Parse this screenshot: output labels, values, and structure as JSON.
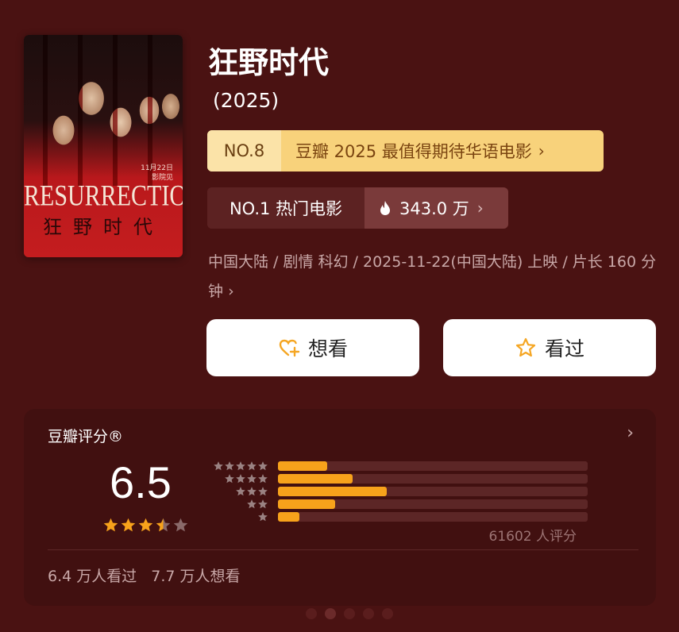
{
  "poster": {
    "title_en": "RESURRECTION",
    "title_cn": "狂野时代",
    "release_note": "11月22日\n影院见"
  },
  "movie": {
    "title": "狂野时代",
    "year": "(2025)"
  },
  "rank_primary": {
    "no": "NO.8",
    "label": "豆瓣 2025 最值得期待华语电影",
    "chevron": "›"
  },
  "rank_secondary": {
    "label": "NO.1 热门电影",
    "heat": "343.0 万",
    "chevron": "›"
  },
  "meta": {
    "text": "中国大陆 / 剧情 科幻 / 2025-11-22(中国大陆) 上映 / 片长 160 分钟",
    "chevron": "›"
  },
  "buttons": {
    "want": "想看",
    "seen": "看过"
  },
  "rating": {
    "title": "豆瓣评分®",
    "score": "6.5",
    "stars": 3.5,
    "raters": "61602 人评分",
    "distribution": [
      {
        "stars": 5,
        "fraction": 0.16
      },
      {
        "stars": 4,
        "fraction": 0.24
      },
      {
        "stars": 3,
        "fraction": 0.35
      },
      {
        "stars": 2,
        "fraction": 0.185
      },
      {
        "stars": 1,
        "fraction": 0.07
      }
    ],
    "seen_count": "6.4 万人看过",
    "want_count": "7.7 万人想看",
    "arrow": "›"
  },
  "colors": {
    "background": "#4a1212",
    "accent_orange": "#f7a21b",
    "gold": "#f8d27b"
  }
}
